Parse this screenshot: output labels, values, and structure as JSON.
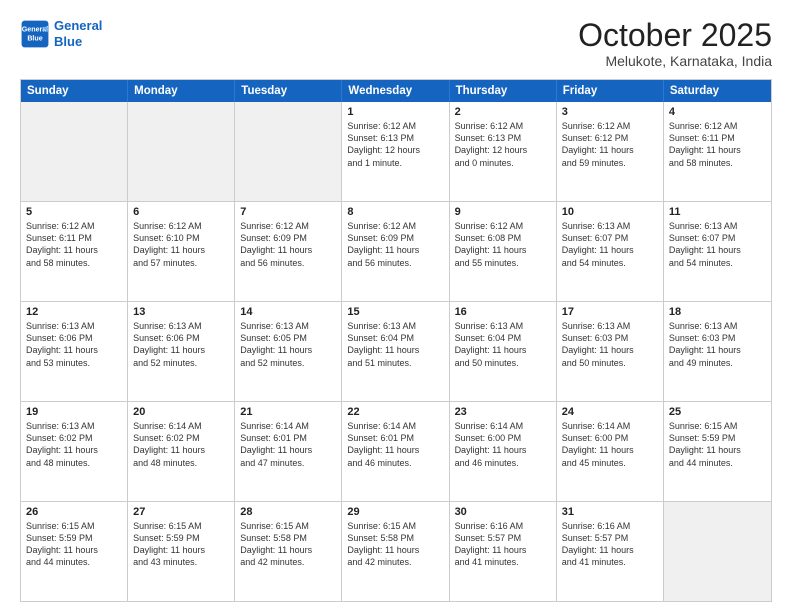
{
  "header": {
    "logo_line1": "General",
    "logo_line2": "Blue",
    "month": "October 2025",
    "location": "Melukote, Karnataka, India"
  },
  "days_of_week": [
    "Sunday",
    "Monday",
    "Tuesday",
    "Wednesday",
    "Thursday",
    "Friday",
    "Saturday"
  ],
  "rows": [
    [
      {
        "day": "",
        "info": "",
        "shaded": true
      },
      {
        "day": "",
        "info": "",
        "shaded": true
      },
      {
        "day": "",
        "info": "",
        "shaded": true
      },
      {
        "day": "1",
        "info": "Sunrise: 6:12 AM\nSunset: 6:13 PM\nDaylight: 12 hours\nand 1 minute.",
        "shaded": false
      },
      {
        "day": "2",
        "info": "Sunrise: 6:12 AM\nSunset: 6:13 PM\nDaylight: 12 hours\nand 0 minutes.",
        "shaded": false
      },
      {
        "day": "3",
        "info": "Sunrise: 6:12 AM\nSunset: 6:12 PM\nDaylight: 11 hours\nand 59 minutes.",
        "shaded": false
      },
      {
        "day": "4",
        "info": "Sunrise: 6:12 AM\nSunset: 6:11 PM\nDaylight: 11 hours\nand 58 minutes.",
        "shaded": false
      }
    ],
    [
      {
        "day": "5",
        "info": "Sunrise: 6:12 AM\nSunset: 6:11 PM\nDaylight: 11 hours\nand 58 minutes.",
        "shaded": false
      },
      {
        "day": "6",
        "info": "Sunrise: 6:12 AM\nSunset: 6:10 PM\nDaylight: 11 hours\nand 57 minutes.",
        "shaded": false
      },
      {
        "day": "7",
        "info": "Sunrise: 6:12 AM\nSunset: 6:09 PM\nDaylight: 11 hours\nand 56 minutes.",
        "shaded": false
      },
      {
        "day": "8",
        "info": "Sunrise: 6:12 AM\nSunset: 6:09 PM\nDaylight: 11 hours\nand 56 minutes.",
        "shaded": false
      },
      {
        "day": "9",
        "info": "Sunrise: 6:12 AM\nSunset: 6:08 PM\nDaylight: 11 hours\nand 55 minutes.",
        "shaded": false
      },
      {
        "day": "10",
        "info": "Sunrise: 6:13 AM\nSunset: 6:07 PM\nDaylight: 11 hours\nand 54 minutes.",
        "shaded": false
      },
      {
        "day": "11",
        "info": "Sunrise: 6:13 AM\nSunset: 6:07 PM\nDaylight: 11 hours\nand 54 minutes.",
        "shaded": false
      }
    ],
    [
      {
        "day": "12",
        "info": "Sunrise: 6:13 AM\nSunset: 6:06 PM\nDaylight: 11 hours\nand 53 minutes.",
        "shaded": false
      },
      {
        "day": "13",
        "info": "Sunrise: 6:13 AM\nSunset: 6:06 PM\nDaylight: 11 hours\nand 52 minutes.",
        "shaded": false
      },
      {
        "day": "14",
        "info": "Sunrise: 6:13 AM\nSunset: 6:05 PM\nDaylight: 11 hours\nand 52 minutes.",
        "shaded": false
      },
      {
        "day": "15",
        "info": "Sunrise: 6:13 AM\nSunset: 6:04 PM\nDaylight: 11 hours\nand 51 minutes.",
        "shaded": false
      },
      {
        "day": "16",
        "info": "Sunrise: 6:13 AM\nSunset: 6:04 PM\nDaylight: 11 hours\nand 50 minutes.",
        "shaded": false
      },
      {
        "day": "17",
        "info": "Sunrise: 6:13 AM\nSunset: 6:03 PM\nDaylight: 11 hours\nand 50 minutes.",
        "shaded": false
      },
      {
        "day": "18",
        "info": "Sunrise: 6:13 AM\nSunset: 6:03 PM\nDaylight: 11 hours\nand 49 minutes.",
        "shaded": false
      }
    ],
    [
      {
        "day": "19",
        "info": "Sunrise: 6:13 AM\nSunset: 6:02 PM\nDaylight: 11 hours\nand 48 minutes.",
        "shaded": false
      },
      {
        "day": "20",
        "info": "Sunrise: 6:14 AM\nSunset: 6:02 PM\nDaylight: 11 hours\nand 48 minutes.",
        "shaded": false
      },
      {
        "day": "21",
        "info": "Sunrise: 6:14 AM\nSunset: 6:01 PM\nDaylight: 11 hours\nand 47 minutes.",
        "shaded": false
      },
      {
        "day": "22",
        "info": "Sunrise: 6:14 AM\nSunset: 6:01 PM\nDaylight: 11 hours\nand 46 minutes.",
        "shaded": false
      },
      {
        "day": "23",
        "info": "Sunrise: 6:14 AM\nSunset: 6:00 PM\nDaylight: 11 hours\nand 46 minutes.",
        "shaded": false
      },
      {
        "day": "24",
        "info": "Sunrise: 6:14 AM\nSunset: 6:00 PM\nDaylight: 11 hours\nand 45 minutes.",
        "shaded": false
      },
      {
        "day": "25",
        "info": "Sunrise: 6:15 AM\nSunset: 5:59 PM\nDaylight: 11 hours\nand 44 minutes.",
        "shaded": false
      }
    ],
    [
      {
        "day": "26",
        "info": "Sunrise: 6:15 AM\nSunset: 5:59 PM\nDaylight: 11 hours\nand 44 minutes.",
        "shaded": false
      },
      {
        "day": "27",
        "info": "Sunrise: 6:15 AM\nSunset: 5:59 PM\nDaylight: 11 hours\nand 43 minutes.",
        "shaded": false
      },
      {
        "day": "28",
        "info": "Sunrise: 6:15 AM\nSunset: 5:58 PM\nDaylight: 11 hours\nand 42 minutes.",
        "shaded": false
      },
      {
        "day": "29",
        "info": "Sunrise: 6:15 AM\nSunset: 5:58 PM\nDaylight: 11 hours\nand 42 minutes.",
        "shaded": false
      },
      {
        "day": "30",
        "info": "Sunrise: 6:16 AM\nSunset: 5:57 PM\nDaylight: 11 hours\nand 41 minutes.",
        "shaded": false
      },
      {
        "day": "31",
        "info": "Sunrise: 6:16 AM\nSunset: 5:57 PM\nDaylight: 11 hours\nand 41 minutes.",
        "shaded": false
      },
      {
        "day": "",
        "info": "",
        "shaded": true
      }
    ]
  ]
}
